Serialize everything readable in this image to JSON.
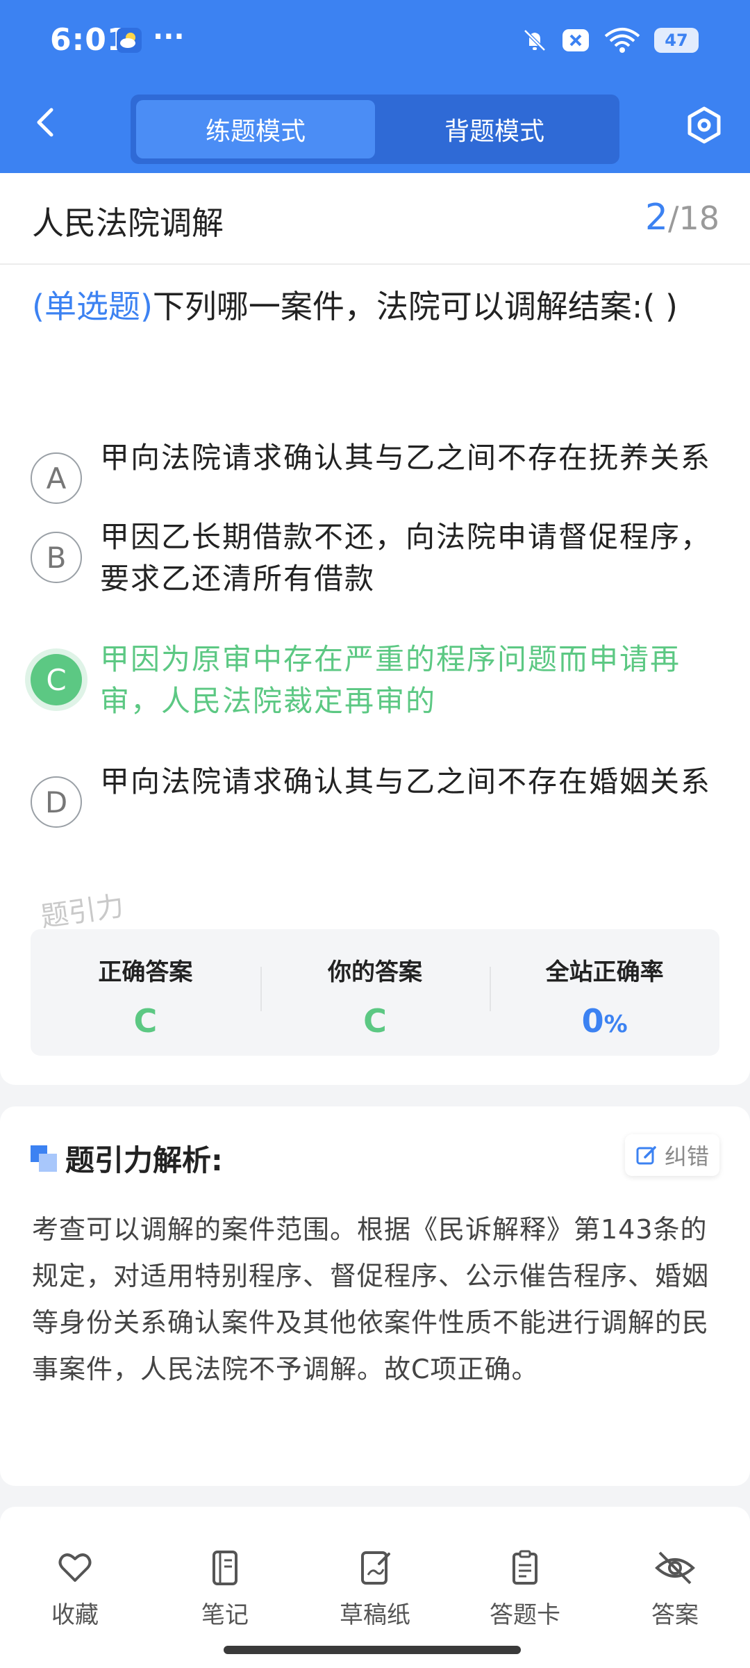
{
  "status_bar": {
    "time": "6:01",
    "dots": "···",
    "battery": "47",
    "icons": [
      "weather-icon",
      "mute-icon",
      "close-box-icon",
      "wifi-icon",
      "battery-icon"
    ]
  },
  "header": {
    "modes": [
      {
        "label": "练题模式",
        "active": true
      },
      {
        "label": "背题模式",
        "active": false
      }
    ],
    "back_icon": "chevron-left-icon",
    "settings_icon": "hexagon-settings-icon"
  },
  "question": {
    "section_title": "人民法院调解",
    "current": "2",
    "total": "/18",
    "type_label": "(单选题)",
    "stem": "下列哪一案件，法院可以调解结案:(     )",
    "options": [
      {
        "letter": "A",
        "text": "甲向法院请求确认其与乙之间不存在抚养关系",
        "correct": false
      },
      {
        "letter": "B",
        "text": "甲因乙长期借款不还，向法院申请督促程序，要求乙还清所有借款",
        "correct": false
      },
      {
        "letter": "C",
        "text": "甲因为原审中存在严重的程序问题而申请再审，人民法院裁定再审的",
        "correct": true
      },
      {
        "letter": "D",
        "text": "甲向法院请求确认其与乙之间不存在婚姻关系",
        "correct": false
      }
    ],
    "watermark": "题引力",
    "stats": {
      "correct_label": "正确答案",
      "correct_value": "C",
      "yours_label": "你的答案",
      "yours_value": "C",
      "rate_label": "全站正确率",
      "rate_value": "0",
      "rate_unit": "%"
    }
  },
  "analysis": {
    "title": "题引力解析:",
    "fix_label": "纠错",
    "text": "考查可以调解的案件范围。根据《民诉解释》第143条的规定，对适用特别程序、督促程序、公示催告程序、婚姻等身份关系确认案件及其他依案件性质不能进行调解的民事案件，人民法院不予调解。故C项正确。"
  },
  "toolbar": {
    "items": [
      {
        "label": "收藏",
        "icon": "heart-icon"
      },
      {
        "label": "笔记",
        "icon": "notebook-icon"
      },
      {
        "label": "草稿纸",
        "icon": "draft-paper-icon"
      },
      {
        "label": "答题卡",
        "icon": "answer-sheet-icon"
      },
      {
        "label": "答案",
        "icon": "eye-off-icon"
      }
    ]
  },
  "colors": {
    "brand_blue": "#3c82f2",
    "correct_green": "#5cc883"
  }
}
